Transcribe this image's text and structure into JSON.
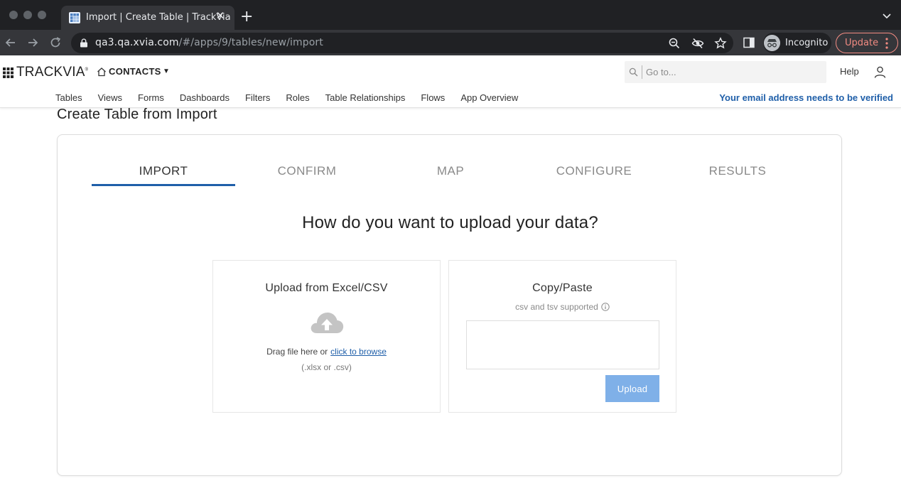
{
  "browser": {
    "tab_title": "Import | Create Table | TrackVia",
    "url_host": "qa3.qa.xvia.com",
    "url_path": "/#/apps/9/tables/new/import",
    "incognito_label": "Incognito",
    "update_label": "Update",
    "icons": [
      "back-arrow-icon",
      "forward-arrow-icon",
      "reload-icon",
      "lock-icon",
      "zoom-icon",
      "eye-slash-icon",
      "star-icon",
      "side-panel-icon",
      "incognito-icon",
      "kebab-menu-icon"
    ]
  },
  "header": {
    "logo": "TRACKVIA",
    "logo_mark": "®",
    "app_name": "CONTACTS",
    "app_caret": "▼",
    "search_placeholder": "Go to...",
    "help_label": "Help",
    "verify_notice": "Your email address needs to be verified",
    "nav": [
      "Tables",
      "Views",
      "Forms",
      "Dashboards",
      "Filters",
      "Roles",
      "Table Relationships",
      "Flows",
      "App Overview"
    ]
  },
  "page": {
    "title": "Create Table from Import",
    "steps": [
      "IMPORT",
      "CONFIRM",
      "MAP",
      "CONFIGURE",
      "RESULTS"
    ],
    "active_step": "IMPORT",
    "heading": "How do you want to upload your data?",
    "excel": {
      "title": "Upload from Excel/CSV",
      "drag_text": "Drag file here or",
      "browse_link": "click to browse",
      "extensions": "(.xlsx or .csv)"
    },
    "paste": {
      "title": "Copy/Paste",
      "hint": "csv and tsv supported",
      "textarea_value": "",
      "upload_label": "Upload"
    }
  },
  "colors": {
    "accent": "#1f5fa9",
    "upload_button": "#7fb0e8",
    "chrome_dark": "#202124",
    "chrome_tab": "#35363a",
    "update_outline": "#f28b82"
  }
}
